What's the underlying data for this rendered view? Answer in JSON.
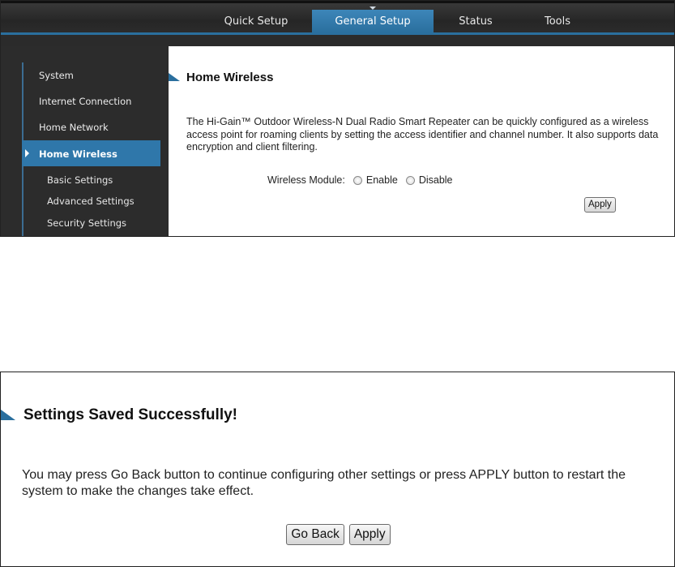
{
  "top_nav": {
    "tabs": [
      {
        "label": "Quick Setup"
      },
      {
        "label": "General Setup",
        "active": true
      },
      {
        "label": "Status"
      },
      {
        "label": "Tools"
      }
    ]
  },
  "sidebar": {
    "items": [
      {
        "label": "System"
      },
      {
        "label": "Internet Connection"
      },
      {
        "label": "Home Network"
      },
      {
        "label": "Home Wireless",
        "active": true
      }
    ],
    "subitems": [
      {
        "label": "Basic Settings"
      },
      {
        "label": "Advanced Settings"
      },
      {
        "label": "Security Settings"
      }
    ]
  },
  "home_wireless": {
    "title": "Home Wireless",
    "description": "The Hi-Gain™ Outdoor Wireless-N Dual Radio Smart Repeater can be quickly configured as a wireless access point for roaming clients by setting the access identifier and channel number. It also supports data encryption and client filtering.",
    "module_label": "Wireless Module:",
    "enable_label": "Enable",
    "disable_label": "Disable",
    "apply_label": "Apply"
  },
  "settings_saved": {
    "title": "Settings Saved Successfully!",
    "description": "You may press Go Back button to continue configuring other settings or press APPLY button to restart the system to make the changes take effect.",
    "go_back_label": "Go Back",
    "apply_label": "Apply"
  },
  "colors": {
    "accent_blue": "#2f77aa",
    "nav_dark": "#2c2c2c"
  }
}
